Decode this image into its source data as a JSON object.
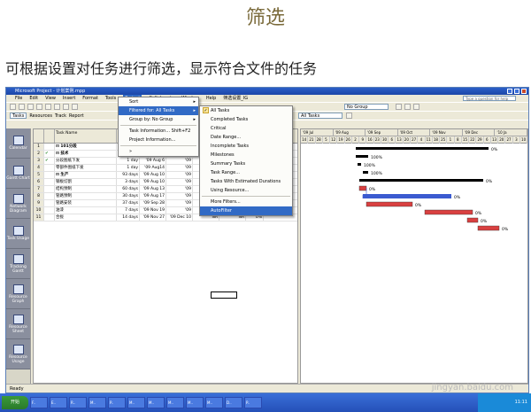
{
  "slide": {
    "title": "筛选",
    "subtitle": "可根据设置对任务进行筛选，显示符合文件的任务"
  },
  "window": {
    "title": "Microsoft Project - 计划案例.mpp"
  },
  "menubar": {
    "items": [
      "File",
      "Edit",
      "View",
      "Insert",
      "Format",
      "Tools",
      "Project",
      "Collaborate",
      "Window",
      "Help",
      "筛选设置_IG"
    ],
    "active": "Project",
    "ask": "Type a question for help"
  },
  "toolbar": {
    "tasks": "Tasks",
    "resources": "Resources",
    "track": "Track",
    "report": "Report",
    "group": "No Group",
    "filter": "All Tasks"
  },
  "views": [
    "Calendar",
    "Gantt Chart",
    "Network Diagram",
    "Task Usage",
    "Tracking Gantt",
    "Resource Graph",
    "Resource Sheet",
    "Resource Usage"
  ],
  "table": {
    "headers": [
      "",
      "",
      "Task Name",
      "Duration",
      "Start",
      "Finish",
      "",
      "",
      "Comp"
    ],
    "rows": [
      {
        "id": "1",
        "ind": "",
        "name": "⊟ 101分段",
        "dur": "",
        "start": "",
        "finish": "",
        "c7": "",
        "c8": "",
        "pct": "0%"
      },
      {
        "id": "2",
        "ind": "✔",
        "name": "  ⊟ 技术",
        "dur": "7 days",
        "start": "'09 Aug 6",
        "finish": "'09",
        "c7": "",
        "c8": "",
        "pct": "100%"
      },
      {
        "id": "3",
        "ind": "✔",
        "name": "      分段图纸下发",
        "dur": "1 day",
        "start": "'09 Aug 6",
        "finish": "'09",
        "c7": "",
        "c8": "",
        "pct": "100%"
      },
      {
        "id": "4",
        "ind": "",
        "name": "      零部件图纸下发",
        "dur": "1 day",
        "start": "'09 Aug14",
        "finish": "'09",
        "c7": "",
        "c8": "",
        "pct": "100%"
      },
      {
        "id": "5",
        "ind": "",
        "name": "  ⊟ 生产",
        "dur": "93 days",
        "start": "'09 Aug 10",
        "finish": "'09",
        "c7": "",
        "c8": "",
        "pct": "0%"
      },
      {
        "id": "6",
        "ind": "",
        "name": "      钢板切割",
        "dur": "3 days",
        "start": "'09 Aug 10",
        "finish": "'09",
        "c7": "",
        "c8": "",
        "pct": "0%"
      },
      {
        "id": "7",
        "ind": "",
        "name": "      结构预制",
        "dur": "60 days",
        "start": "'09 Aug 13",
        "finish": "'09",
        "c7": "",
        "c8": "",
        "pct": "0%"
      },
      {
        "id": "8",
        "ind": "",
        "name": "      管路预制",
        "dur": "30 days",
        "start": "'09 Aug 17",
        "finish": "'09",
        "c7": "",
        "c8": "",
        "pct": "0%"
      },
      {
        "id": "9",
        "ind": "",
        "name": "      管路安装",
        "dur": "37 days",
        "start": "'09 Sep 28",
        "finish": "'09",
        "c7": "",
        "c8": "",
        "pct": "0%"
      },
      {
        "id": "10",
        "ind": "",
        "name": "      油漆",
        "dur": "7 days",
        "start": "'09 Nov 19",
        "finish": "'09",
        "c7": "",
        "c8": "",
        "pct": "0%"
      },
      {
        "id": "11",
        "ind": "",
        "name": "      合拢",
        "dur": "14 days",
        "start": "'09 Nov 27",
        "finish": "'09 Dec 10",
        "c7": "NA",
        "c8": "NA",
        "pct": "0%"
      }
    ]
  },
  "gantt": {
    "months": [
      "'09 Jul",
      "'09 Aug",
      "'09 Sep",
      "'09 Oct",
      "'09 Nov",
      "'09 Dec",
      "'10 Ja"
    ],
    "days": [
      "14",
      "21",
      "28",
      "5",
      "12",
      "19",
      "26",
      "2",
      "9",
      "16",
      "23",
      "30",
      "6",
      "13",
      "20",
      "27",
      "4",
      "11",
      "18",
      "25",
      "1",
      "8",
      "15",
      "22",
      "29",
      "6",
      "13",
      "20",
      "27",
      "3",
      "10"
    ],
    "labels": [
      "0%",
      "100%",
      "100%",
      "100%",
      "0%",
      "0%",
      "0%",
      "0%",
      "0%",
      "0%",
      "0%"
    ]
  },
  "project_menu": {
    "items": [
      "Sort",
      "Filtered for: All Tasks",
      "Group by: No Group",
      "Task Information...  Shift+F2",
      "Project Information...",
      "»"
    ]
  },
  "filter_menu": {
    "items": [
      "All Tasks",
      "Completed Tasks",
      "Critical",
      "Date Range...",
      "Incomplete Tasks",
      "Milestones",
      "Summary Tasks",
      "Task Range...",
      "Tasks With Estimated Durations",
      "Using Resource...",
      "More Filters...",
      "AutoFilter"
    ]
  },
  "status": {
    "text": "Ready"
  },
  "taskbar": {
    "start": "开始",
    "tasks": [
      "F..",
      "E..",
      "R..",
      "M..",
      "P..",
      "M..",
      "M..",
      "M..",
      "M..",
      "M..",
      "D..",
      "P.."
    ],
    "time": "11:11"
  },
  "watermark": "jingyan.baidu.com",
  "colors": {
    "bar_blue": "#3b5bd0",
    "bar_red": "#d94040",
    "summary": "#000000",
    "menu_highlight": "#316ac5"
  }
}
